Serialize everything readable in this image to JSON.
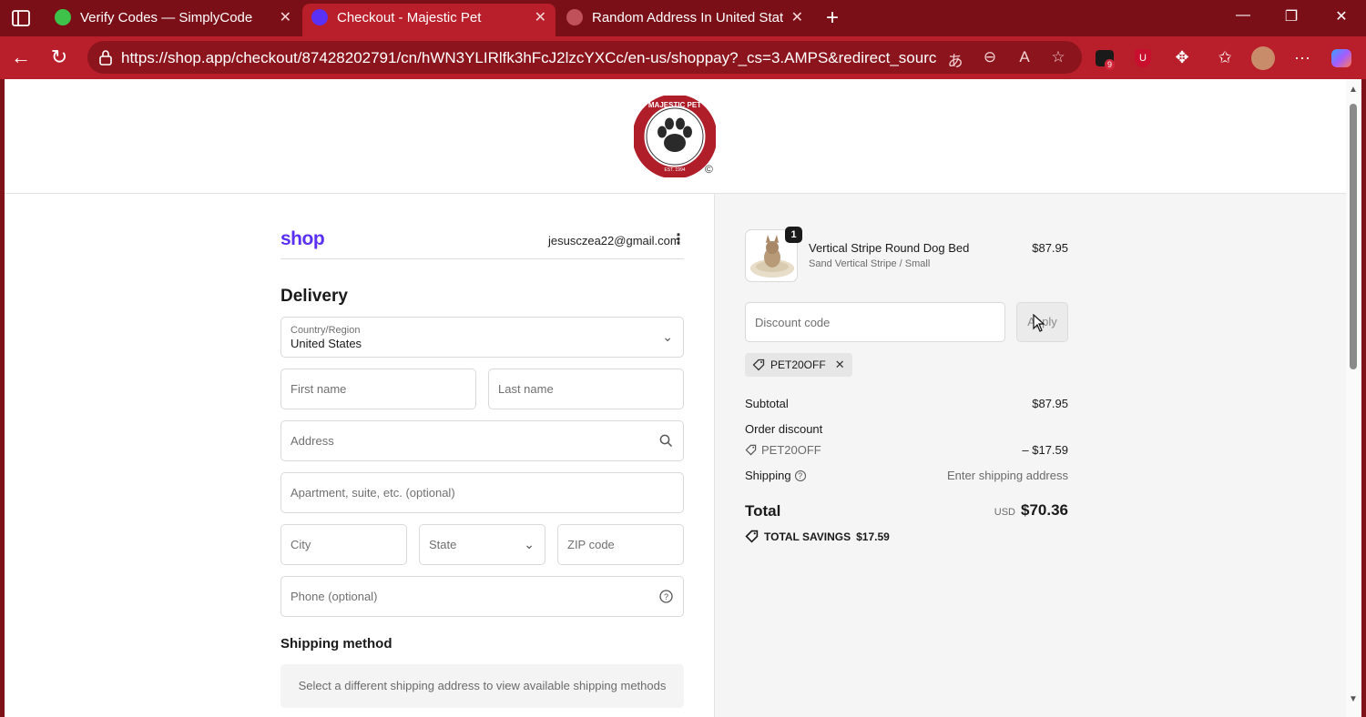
{
  "browser": {
    "tabs": [
      {
        "title": "Verify Codes — SimplyCodes",
        "active": false
      },
      {
        "title": "Checkout - Majestic Pet",
        "active": true
      },
      {
        "title": "Random Address In United States",
        "active": false
      }
    ],
    "url": "https://shop.app/checkout/87428202791/cn/hWN3YLIRlfk3hFcJ2lzcYXCc/en-us/shoppay?_cs=3.AMPS&redirect_source=di...",
    "extension_badge": "9",
    "colors": {
      "frame": "#7a0f17",
      "toolbar": "#b81f2a"
    }
  },
  "store": {
    "logo_text": "MAJESTIC PET",
    "logo_est": "EST. 1994",
    "copyright": "©"
  },
  "account": {
    "brand": "shop",
    "email": "jesusczea22@gmail.com"
  },
  "delivery": {
    "heading": "Delivery",
    "country_label": "Country/Region",
    "country_value": "United States",
    "first_name_placeholder": "First name",
    "last_name_placeholder": "Last name",
    "address_placeholder": "Address",
    "apartment_placeholder": "Apartment, suite, etc. (optional)",
    "city_placeholder": "City",
    "state_placeholder": "State",
    "zip_placeholder": "ZIP code",
    "phone_placeholder": "Phone (optional)"
  },
  "shipping_method": {
    "heading": "Shipping method",
    "note": "Select a different shipping address to view available shipping methods"
  },
  "summary": {
    "item": {
      "quantity": "1",
      "name": "Vertical Stripe Round Dog Bed",
      "variant": "Sand Vertical Stripe / Small",
      "price": "$87.95"
    },
    "discount_placeholder": "Discount code",
    "apply_label": "Apply",
    "applied_code": "PET20OFF",
    "subtotal_label": "Subtotal",
    "subtotal_value": "$87.95",
    "order_discount_label": "Order discount",
    "order_discount_code": "PET20OFF",
    "order_discount_value": "– $17.59",
    "shipping_label": "Shipping",
    "shipping_value": "Enter shipping address",
    "total_label": "Total",
    "total_currency": "USD",
    "total_value": "$70.36",
    "savings_label": "TOTAL SAVINGS",
    "savings_value": "$17.59",
    "accent": "#5a31f4"
  }
}
